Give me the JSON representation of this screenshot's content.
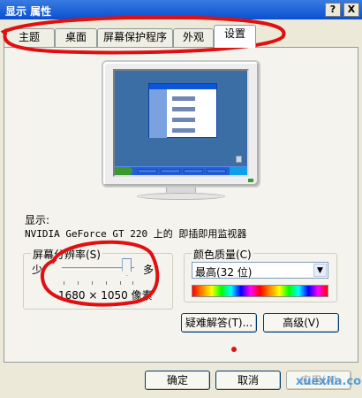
{
  "window": {
    "title": "显示 属性",
    "help_label": "?",
    "close_label": "X"
  },
  "tabs": [
    {
      "label": "主题",
      "active": false
    },
    {
      "label": "桌面",
      "active": false
    },
    {
      "label": "屏幕保护程序",
      "active": false
    },
    {
      "label": "外观",
      "active": false
    },
    {
      "label": "设置",
      "active": true
    }
  ],
  "display": {
    "label": "显示:",
    "device": "NVIDIA GeForce GT 220 上的 即插即用监视器"
  },
  "resolution": {
    "group_label": "屏幕分辨率(S)",
    "min_label": "少",
    "max_label": "多",
    "value_text": "1680 × 1050 像素",
    "slider_level": 0.9
  },
  "color_quality": {
    "group_label": "颜色质量(C)",
    "selected": "最高(32 位)"
  },
  "buttons": {
    "troubleshoot": "疑难解答(T)...",
    "advanced": "高级(V)",
    "ok": "确定",
    "cancel": "取消",
    "apply": "应用(A)"
  },
  "icons": {
    "dropdown": "chevron-down-icon"
  },
  "watermark": "xuexila.com",
  "colors": {
    "annotation_red": "#e01010",
    "title_blue": "#0a4fd0"
  }
}
